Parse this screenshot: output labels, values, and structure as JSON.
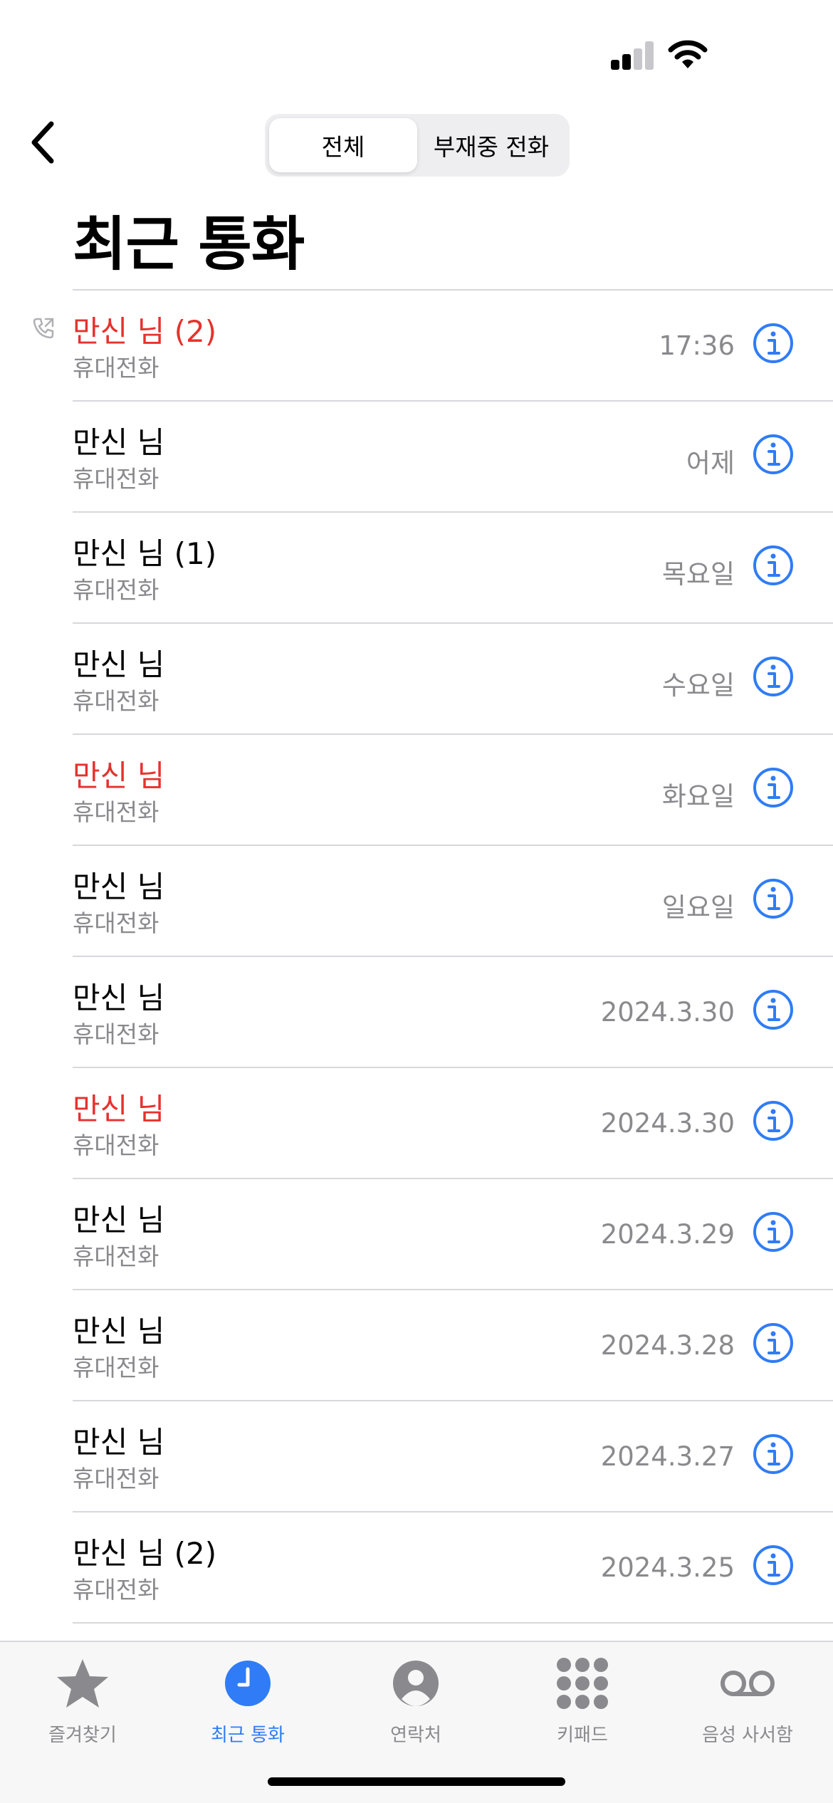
{
  "colors": {
    "accent": "#2f7cf6",
    "missed": "#e5322d",
    "secondary": "#8a8a8e"
  },
  "nav": {
    "segments": [
      {
        "label": "전체",
        "active": true
      },
      {
        "label": "부재중 전화",
        "active": false
      }
    ]
  },
  "title": "최근 통화",
  "calls": [
    {
      "name": "만신 님 (2)",
      "type": "휴대전화",
      "time": "17:36",
      "missed": true
    },
    {
      "name": "만신 님",
      "type": "휴대전화",
      "time": "어제",
      "missed": false
    },
    {
      "name": "만신 님 (1)",
      "type": "휴대전화",
      "time": "목요일",
      "missed": false
    },
    {
      "name": "만신 님",
      "type": "휴대전화",
      "time": "수요일",
      "missed": false
    },
    {
      "name": "만신 님",
      "type": "휴대전화",
      "time": "화요일",
      "missed": true
    },
    {
      "name": "만신 님",
      "type": "휴대전화",
      "time": "일요일",
      "missed": false
    },
    {
      "name": "만신 님",
      "type": "휴대전화",
      "time": "2024.3.30",
      "missed": false
    },
    {
      "name": "만신 님",
      "type": "휴대전화",
      "time": "2024.3.30",
      "missed": true
    },
    {
      "name": "만신 님",
      "type": "휴대전화",
      "time": "2024.3.29",
      "missed": false
    },
    {
      "name": "만신 님",
      "type": "휴대전화",
      "time": "2024.3.28",
      "missed": false
    },
    {
      "name": "만신 님",
      "type": "휴대전화",
      "time": "2024.3.27",
      "missed": false
    },
    {
      "name": "만신 님 (2)",
      "type": "휴대전화",
      "time": "2024.3.25",
      "missed": false
    }
  ],
  "tabs": [
    {
      "label": "즐겨찾기",
      "icon": "star-icon",
      "active": false
    },
    {
      "label": "최근 통화",
      "icon": "clock-icon",
      "active": true
    },
    {
      "label": "연락처",
      "icon": "contact-icon",
      "active": false
    },
    {
      "label": "키패드",
      "icon": "keypad-icon",
      "active": false
    },
    {
      "label": "음성 사서함",
      "icon": "voicemail-icon",
      "active": false
    }
  ]
}
